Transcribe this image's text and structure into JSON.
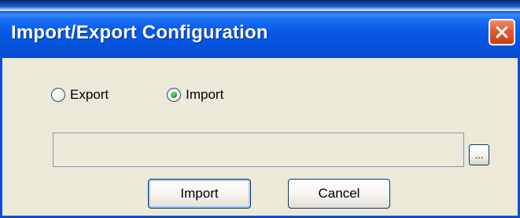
{
  "dialog": {
    "title": "Import/Export Configuration",
    "close_icon": "close-icon"
  },
  "mode": {
    "options": [
      {
        "label": "Export",
        "selected": false
      },
      {
        "label": "Import",
        "selected": true
      }
    ]
  },
  "file": {
    "path_value": "",
    "browse_label": "..."
  },
  "actions": {
    "import_label": "Import",
    "cancel_label": "Cancel"
  },
  "colors": {
    "titlebar": "#0658e6",
    "close_button": "#e25a33",
    "dialog_background": "#ece9d8",
    "radio_selected": "#29a829"
  }
}
